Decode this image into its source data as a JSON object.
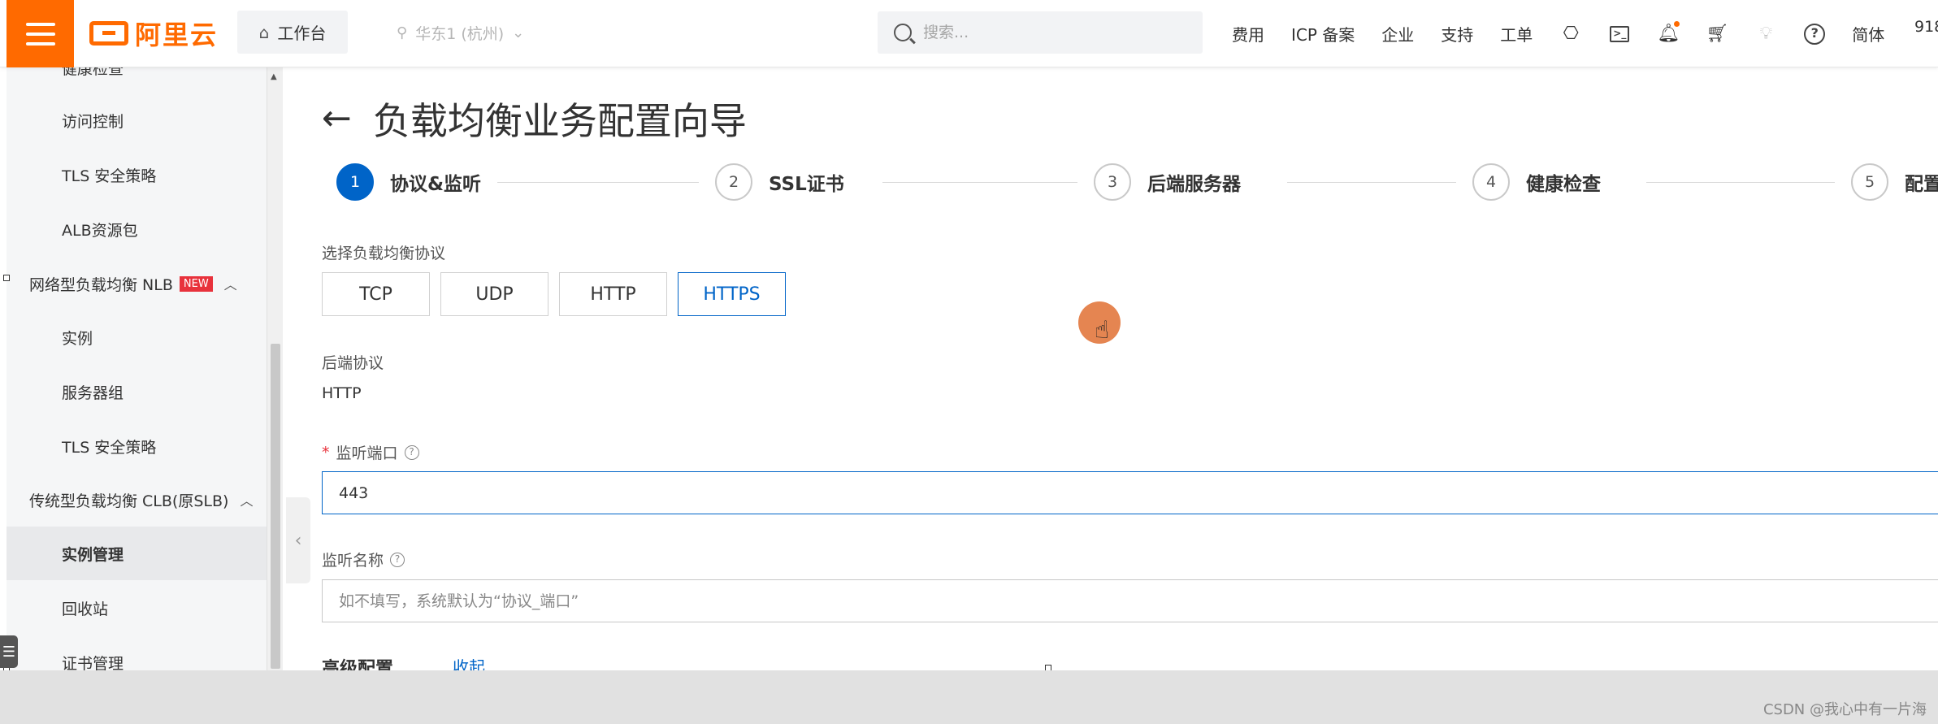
{
  "topbar": {
    "logo_text": "阿里云",
    "workbench_label": "工作台",
    "region_label": "华东1 (杭州)",
    "search_placeholder": "搜索...",
    "links": [
      "费用",
      "ICP 备案",
      "企业",
      "支持",
      "工单"
    ],
    "lang_label": "简体",
    "account_text": "918"
  },
  "sidebar": {
    "items": [
      {
        "label": "健康检查"
      },
      {
        "label": "访问控制"
      },
      {
        "label": "TLS 安全策略"
      },
      {
        "label": "ALB资源包"
      },
      {
        "label": "网络型负载均衡 NLB",
        "badge": "NEW"
      },
      {
        "label": "实例"
      },
      {
        "label": "服务器组"
      },
      {
        "label": "TLS 安全策略"
      },
      {
        "label": "传统型负载均衡 CLB(原SLB)"
      },
      {
        "label": "实例管理"
      },
      {
        "label": "回收站"
      },
      {
        "label": "证书管理"
      }
    ]
  },
  "page": {
    "title": "负载均衡业务配置向导",
    "steps": [
      {
        "num": "1",
        "label": "协议&监听"
      },
      {
        "num": "2",
        "label": "SSL证书"
      },
      {
        "num": "3",
        "label": "后端服务器"
      },
      {
        "num": "4",
        "label": "健康检查"
      },
      {
        "num": "5",
        "label": "配置"
      }
    ],
    "protocol_label": "选择负载均衡协议",
    "protocols": [
      "TCP",
      "UDP",
      "HTTP",
      "HTTPS"
    ],
    "selected_protocol": "HTTPS",
    "backend_label": "后端协议",
    "backend_value": "HTTP",
    "port_label": "监听端口",
    "port_value": "443",
    "name_label": "监听名称",
    "name_placeholder": "如不填写，系统默认为“协议_端口”",
    "advanced_label": "高级配置",
    "advanced_link": "收起"
  },
  "footer": {
    "watermark": "CSDN @我心中有一片海"
  },
  "colors": {
    "brand": "#ff6a00",
    "primary": "#0064c8"
  }
}
